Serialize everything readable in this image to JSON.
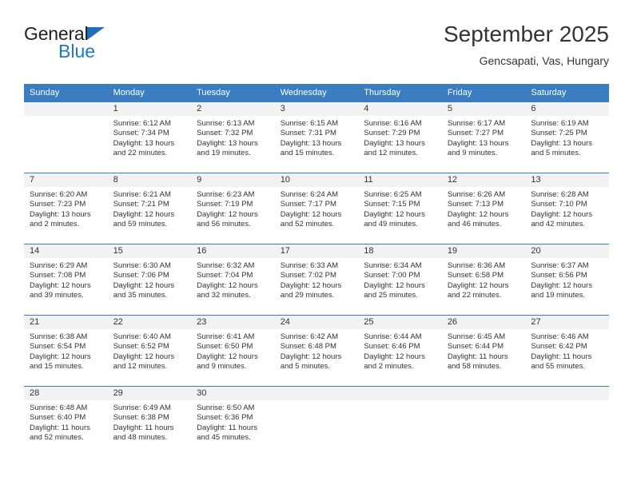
{
  "brand": {
    "line1": "General",
    "line2": "Blue",
    "triangle_color": "#1f70b8"
  },
  "header": {
    "title": "September 2025",
    "subtitle": "Gencsapati, Vas, Hungary"
  },
  "theme": {
    "header_blue": "#3b7dc0",
    "day_band_gray": "#f2f2f2",
    "text": "#333333"
  },
  "weekdays": [
    "Sunday",
    "Monday",
    "Tuesday",
    "Wednesday",
    "Thursday",
    "Friday",
    "Saturday"
  ],
  "weeks": [
    [
      {
        "day": "",
        "sunrise": "",
        "sunset": "",
        "daylight1": "",
        "daylight2": ""
      },
      {
        "day": "1",
        "sunrise": "Sunrise: 6:12 AM",
        "sunset": "Sunset: 7:34 PM",
        "daylight1": "Daylight: 13 hours",
        "daylight2": "and 22 minutes."
      },
      {
        "day": "2",
        "sunrise": "Sunrise: 6:13 AM",
        "sunset": "Sunset: 7:32 PM",
        "daylight1": "Daylight: 13 hours",
        "daylight2": "and 19 minutes."
      },
      {
        "day": "3",
        "sunrise": "Sunrise: 6:15 AM",
        "sunset": "Sunset: 7:31 PM",
        "daylight1": "Daylight: 13 hours",
        "daylight2": "and 15 minutes."
      },
      {
        "day": "4",
        "sunrise": "Sunrise: 6:16 AM",
        "sunset": "Sunset: 7:29 PM",
        "daylight1": "Daylight: 13 hours",
        "daylight2": "and 12 minutes."
      },
      {
        "day": "5",
        "sunrise": "Sunrise: 6:17 AM",
        "sunset": "Sunset: 7:27 PM",
        "daylight1": "Daylight: 13 hours",
        "daylight2": "and 9 minutes."
      },
      {
        "day": "6",
        "sunrise": "Sunrise: 6:19 AM",
        "sunset": "Sunset: 7:25 PM",
        "daylight1": "Daylight: 13 hours",
        "daylight2": "and 5 minutes."
      }
    ],
    [
      {
        "day": "7",
        "sunrise": "Sunrise: 6:20 AM",
        "sunset": "Sunset: 7:23 PM",
        "daylight1": "Daylight: 13 hours",
        "daylight2": "and 2 minutes."
      },
      {
        "day": "8",
        "sunrise": "Sunrise: 6:21 AM",
        "sunset": "Sunset: 7:21 PM",
        "daylight1": "Daylight: 12 hours",
        "daylight2": "and 59 minutes."
      },
      {
        "day": "9",
        "sunrise": "Sunrise: 6:23 AM",
        "sunset": "Sunset: 7:19 PM",
        "daylight1": "Daylight: 12 hours",
        "daylight2": "and 56 minutes."
      },
      {
        "day": "10",
        "sunrise": "Sunrise: 6:24 AM",
        "sunset": "Sunset: 7:17 PM",
        "daylight1": "Daylight: 12 hours",
        "daylight2": "and 52 minutes."
      },
      {
        "day": "11",
        "sunrise": "Sunrise: 6:25 AM",
        "sunset": "Sunset: 7:15 PM",
        "daylight1": "Daylight: 12 hours",
        "daylight2": "and 49 minutes."
      },
      {
        "day": "12",
        "sunrise": "Sunrise: 6:26 AM",
        "sunset": "Sunset: 7:13 PM",
        "daylight1": "Daylight: 12 hours",
        "daylight2": "and 46 minutes."
      },
      {
        "day": "13",
        "sunrise": "Sunrise: 6:28 AM",
        "sunset": "Sunset: 7:10 PM",
        "daylight1": "Daylight: 12 hours",
        "daylight2": "and 42 minutes."
      }
    ],
    [
      {
        "day": "14",
        "sunrise": "Sunrise: 6:29 AM",
        "sunset": "Sunset: 7:08 PM",
        "daylight1": "Daylight: 12 hours",
        "daylight2": "and 39 minutes."
      },
      {
        "day": "15",
        "sunrise": "Sunrise: 6:30 AM",
        "sunset": "Sunset: 7:06 PM",
        "daylight1": "Daylight: 12 hours",
        "daylight2": "and 35 minutes."
      },
      {
        "day": "16",
        "sunrise": "Sunrise: 6:32 AM",
        "sunset": "Sunset: 7:04 PM",
        "daylight1": "Daylight: 12 hours",
        "daylight2": "and 32 minutes."
      },
      {
        "day": "17",
        "sunrise": "Sunrise: 6:33 AM",
        "sunset": "Sunset: 7:02 PM",
        "daylight1": "Daylight: 12 hours",
        "daylight2": "and 29 minutes."
      },
      {
        "day": "18",
        "sunrise": "Sunrise: 6:34 AM",
        "sunset": "Sunset: 7:00 PM",
        "daylight1": "Daylight: 12 hours",
        "daylight2": "and 25 minutes."
      },
      {
        "day": "19",
        "sunrise": "Sunrise: 6:36 AM",
        "sunset": "Sunset: 6:58 PM",
        "daylight1": "Daylight: 12 hours",
        "daylight2": "and 22 minutes."
      },
      {
        "day": "20",
        "sunrise": "Sunrise: 6:37 AM",
        "sunset": "Sunset: 6:56 PM",
        "daylight1": "Daylight: 12 hours",
        "daylight2": "and 19 minutes."
      }
    ],
    [
      {
        "day": "21",
        "sunrise": "Sunrise: 6:38 AM",
        "sunset": "Sunset: 6:54 PM",
        "daylight1": "Daylight: 12 hours",
        "daylight2": "and 15 minutes."
      },
      {
        "day": "22",
        "sunrise": "Sunrise: 6:40 AM",
        "sunset": "Sunset: 6:52 PM",
        "daylight1": "Daylight: 12 hours",
        "daylight2": "and 12 minutes."
      },
      {
        "day": "23",
        "sunrise": "Sunrise: 6:41 AM",
        "sunset": "Sunset: 6:50 PM",
        "daylight1": "Daylight: 12 hours",
        "daylight2": "and 9 minutes."
      },
      {
        "day": "24",
        "sunrise": "Sunrise: 6:42 AM",
        "sunset": "Sunset: 6:48 PM",
        "daylight1": "Daylight: 12 hours",
        "daylight2": "and 5 minutes."
      },
      {
        "day": "25",
        "sunrise": "Sunrise: 6:44 AM",
        "sunset": "Sunset: 6:46 PM",
        "daylight1": "Daylight: 12 hours",
        "daylight2": "and 2 minutes."
      },
      {
        "day": "26",
        "sunrise": "Sunrise: 6:45 AM",
        "sunset": "Sunset: 6:44 PM",
        "daylight1": "Daylight: 11 hours",
        "daylight2": "and 58 minutes."
      },
      {
        "day": "27",
        "sunrise": "Sunrise: 6:46 AM",
        "sunset": "Sunset: 6:42 PM",
        "daylight1": "Daylight: 11 hours",
        "daylight2": "and 55 minutes."
      }
    ],
    [
      {
        "day": "28",
        "sunrise": "Sunrise: 6:48 AM",
        "sunset": "Sunset: 6:40 PM",
        "daylight1": "Daylight: 11 hours",
        "daylight2": "and 52 minutes."
      },
      {
        "day": "29",
        "sunrise": "Sunrise: 6:49 AM",
        "sunset": "Sunset: 6:38 PM",
        "daylight1": "Daylight: 11 hours",
        "daylight2": "and 48 minutes."
      },
      {
        "day": "30",
        "sunrise": "Sunrise: 6:50 AM",
        "sunset": "Sunset: 6:36 PM",
        "daylight1": "Daylight: 11 hours",
        "daylight2": "and 45 minutes."
      },
      {
        "day": "",
        "sunrise": "",
        "sunset": "",
        "daylight1": "",
        "daylight2": ""
      },
      {
        "day": "",
        "sunrise": "",
        "sunset": "",
        "daylight1": "",
        "daylight2": ""
      },
      {
        "day": "",
        "sunrise": "",
        "sunset": "",
        "daylight1": "",
        "daylight2": ""
      },
      {
        "day": "",
        "sunrise": "",
        "sunset": "",
        "daylight1": "",
        "daylight2": ""
      }
    ]
  ]
}
